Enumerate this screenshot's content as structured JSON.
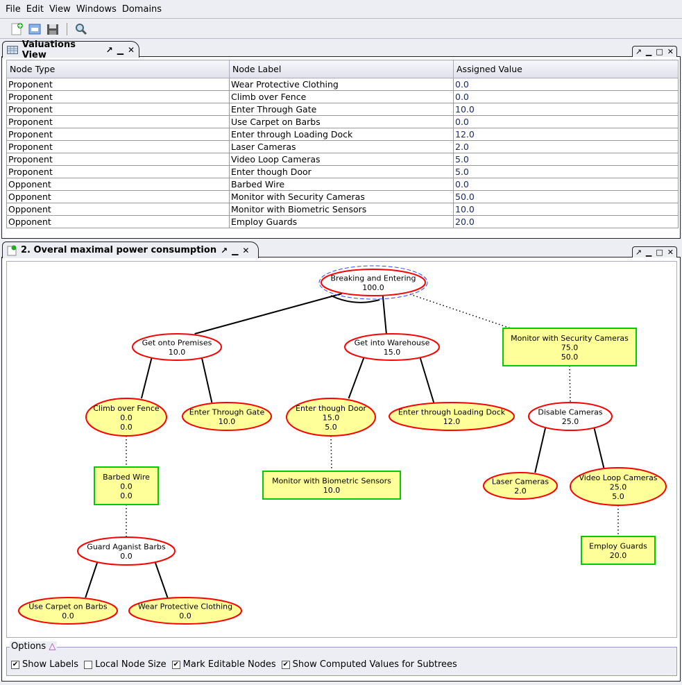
{
  "menu": [
    "File",
    "Edit",
    "View",
    "Windows",
    "Domains"
  ],
  "toolbar": {
    "icons": [
      "new-icon",
      "print-icon",
      "save-icon",
      "search-icon"
    ]
  },
  "valuations": {
    "title": "Valuations View",
    "columns": [
      "Node Type",
      "Node Label",
      "Assigned Value"
    ],
    "rows": [
      [
        "Proponent",
        "Wear Protective Clothing",
        "0.0"
      ],
      [
        "Proponent",
        "Climb over Fence",
        "0.0"
      ],
      [
        "Proponent",
        "Enter Through Gate",
        "10.0"
      ],
      [
        "Proponent",
        "Use Carpet on Barbs",
        "0.0"
      ],
      [
        "Proponent",
        "Enter through Loading Dock",
        "12.0"
      ],
      [
        "Proponent",
        "Laser Cameras",
        "2.0"
      ],
      [
        "Proponent",
        "Video Loop Cameras",
        "5.0"
      ],
      [
        "Proponent",
        "Enter though Door",
        "5.0"
      ],
      [
        "Opponent",
        "Barbed Wire",
        "0.0"
      ],
      [
        "Opponent",
        "Monitor with Security Cameras",
        "50.0"
      ],
      [
        "Opponent",
        "Monitor with Biometric Sensors",
        "10.0"
      ],
      [
        "Opponent",
        "Employ Guards",
        "20.0"
      ]
    ]
  },
  "tree": {
    "title": "2. Overal maximal power consumption",
    "colors": {
      "node_border": "#ff0000",
      "editable_fill": "#ffff99",
      "counter_border": "#00cc00",
      "selection": "#3344ff"
    },
    "nodes": [
      {
        "id": "root",
        "lines": [
          "Breaking and Entering",
          "100.0"
        ],
        "kind": "ellipse",
        "editable": false,
        "selected": true
      },
      {
        "id": "prem",
        "lines": [
          "Get onto Premises",
          "10.0"
        ],
        "kind": "ellipse",
        "editable": false
      },
      {
        "id": "ware",
        "lines": [
          "Get into Warehouse",
          "15.0"
        ],
        "kind": "ellipse",
        "editable": false
      },
      {
        "id": "msc",
        "lines": [
          "Monitor with Security Cameras",
          "75.0",
          "50.0"
        ],
        "kind": "rect",
        "editable": true
      },
      {
        "id": "fence",
        "lines": [
          "Climb over Fence",
          "0.0",
          "0.0"
        ],
        "kind": "ellipse",
        "editable": true
      },
      {
        "id": "gate",
        "lines": [
          "Enter Through Gate",
          "10.0"
        ],
        "kind": "ellipse",
        "editable": true
      },
      {
        "id": "door",
        "lines": [
          "Enter though Door",
          "15.0",
          "5.0"
        ],
        "kind": "ellipse",
        "editable": true
      },
      {
        "id": "dock",
        "lines": [
          "Enter through Loading Dock",
          "12.0"
        ],
        "kind": "ellipse",
        "editable": true
      },
      {
        "id": "disable",
        "lines": [
          "Disable Cameras",
          "25.0"
        ],
        "kind": "ellipse",
        "editable": false
      },
      {
        "id": "barbed",
        "lines": [
          "Barbed Wire",
          "0.0",
          "0.0"
        ],
        "kind": "rect",
        "editable": true
      },
      {
        "id": "bio",
        "lines": [
          "Monitor with Biometric Sensors",
          "10.0"
        ],
        "kind": "rect",
        "editable": true
      },
      {
        "id": "laser",
        "lines": [
          "Laser Cameras",
          "2.0"
        ],
        "kind": "ellipse",
        "editable": true
      },
      {
        "id": "loop",
        "lines": [
          "Video Loop Cameras",
          "25.0",
          "5.0"
        ],
        "kind": "ellipse",
        "editable": true
      },
      {
        "id": "guardb",
        "lines": [
          "Guard Aganist Barbs",
          "0.0"
        ],
        "kind": "ellipse",
        "editable": false
      },
      {
        "id": "guards",
        "lines": [
          "Employ Guards",
          "20.0"
        ],
        "kind": "rect",
        "editable": true
      },
      {
        "id": "carpet",
        "lines": [
          "Use Carpet on Barbs",
          "0.0"
        ],
        "kind": "ellipse",
        "editable": true
      },
      {
        "id": "wear",
        "lines": [
          "Wear Protective Clothing",
          "0.0"
        ],
        "kind": "ellipse",
        "editable": true
      }
    ],
    "edges": [
      [
        "root",
        "prem",
        "solid"
      ],
      [
        "root",
        "ware",
        "solid"
      ],
      [
        "root",
        "msc",
        "dotted"
      ],
      [
        "prem",
        "fence",
        "solid"
      ],
      [
        "prem",
        "gate",
        "solid"
      ],
      [
        "ware",
        "door",
        "solid"
      ],
      [
        "ware",
        "dock",
        "solid"
      ],
      [
        "msc",
        "disable",
        "dotted"
      ],
      [
        "fence",
        "barbed",
        "dotted"
      ],
      [
        "door",
        "bio",
        "dotted"
      ],
      [
        "disable",
        "laser",
        "solid"
      ],
      [
        "disable",
        "loop",
        "solid"
      ],
      [
        "barbed",
        "guardb",
        "dotted"
      ],
      [
        "loop",
        "guards",
        "dotted"
      ],
      [
        "guardb",
        "carpet",
        "solid"
      ],
      [
        "guardb",
        "wear",
        "solid"
      ]
    ]
  },
  "options": {
    "legend": "Options",
    "items": [
      {
        "label": "Show Labels",
        "checked": true
      },
      {
        "label": "Local Node Size",
        "checked": false
      },
      {
        "label": "Mark Editable Nodes",
        "checked": true
      },
      {
        "label": "Show Computed Values for Subtrees",
        "checked": true
      }
    ]
  }
}
